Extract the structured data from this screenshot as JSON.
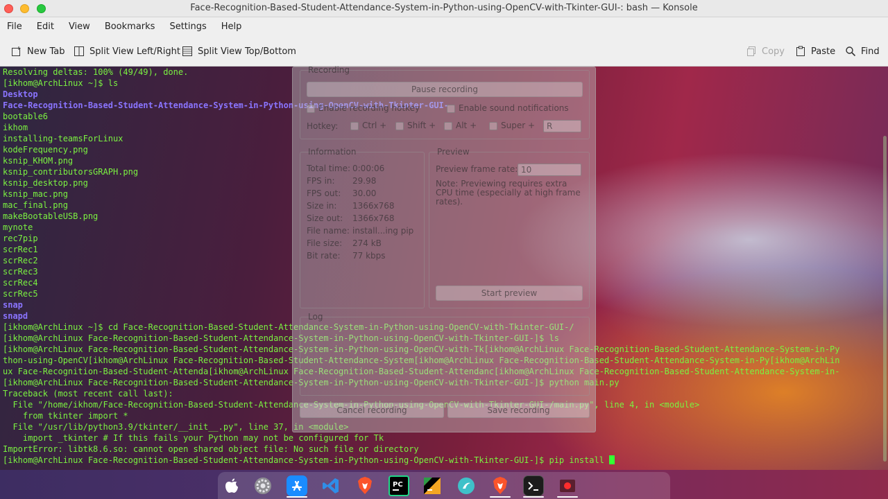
{
  "window": {
    "title": "Face-Recognition-Based-Student-Attendance-System-in-Python-using-OpenCV-with-Tkinter-GUI-: bash — Konsole"
  },
  "menubar": {
    "items": [
      "File",
      "Edit",
      "View",
      "Bookmarks",
      "Settings",
      "Help"
    ]
  },
  "toolbar": {
    "new_tab": "New Tab",
    "split_lr": "Split View Left/Right",
    "split_tb": "Split View Top/Bottom",
    "copy": "Copy",
    "paste": "Paste",
    "find": "Find"
  },
  "terminal": {
    "lines": [
      {
        "text": "Resolving deltas: 100% (49/49), done.",
        "style": "plain"
      },
      {
        "text": "[ikhom@ArchLinux ~]$ ls",
        "style": "plain"
      },
      {
        "text": "Desktop",
        "style": "dir"
      },
      {
        "text": "Face-Recognition-Based-Student-Attendance-System-in-Python-using-OpenCV-with-Tkinter-GUI-",
        "style": "dir"
      },
      {
        "text": "bootable6",
        "style": "plain"
      },
      {
        "text": "ikhom",
        "style": "plain"
      },
      {
        "text": "installing-teamsForLinux",
        "style": "plain"
      },
      {
        "text": "kodeFrequency.png",
        "style": "plain"
      },
      {
        "text": "ksnip_KHOM.png",
        "style": "plain"
      },
      {
        "text": "ksnip_contributorsGRAPH.png",
        "style": "plain"
      },
      {
        "text": "ksnip_desktop.png",
        "style": "plain"
      },
      {
        "text": "ksnip_mac.png",
        "style": "plain"
      },
      {
        "text": "mac_final.png",
        "style": "plain"
      },
      {
        "text": "makeBootableUSB.png",
        "style": "plain"
      },
      {
        "text": "mynote",
        "style": "plain"
      },
      {
        "text": "rec7pip",
        "style": "plain"
      },
      {
        "text": "scrRec1",
        "style": "plain"
      },
      {
        "text": "scrRec2",
        "style": "plain"
      },
      {
        "text": "scrRec3",
        "style": "plain"
      },
      {
        "text": "scrRec4",
        "style": "plain"
      },
      {
        "text": "scrRec5",
        "style": "plain"
      },
      {
        "text": "snap",
        "style": "dir"
      },
      {
        "text": "snapd",
        "style": "dir"
      },
      {
        "text": "[ikhom@ArchLinux ~]$ cd Face-Recognition-Based-Student-Attendance-System-in-Python-using-OpenCV-with-Tkinter-GUI-/",
        "style": "plain"
      },
      {
        "text": "[ikhom@ArchLinux Face-Recognition-Based-Student-Attendance-System-in-Python-using-OpenCV-with-Tkinter-GUI-]$ ls",
        "style": "plain"
      },
      {
        "text": "[ikhom@ArchLinux Face-Recognition-Based-Student-Attendance-System-in-Python-using-OpenCV-with-Tk[ikhom@ArchLinux Face-Recognition-Based-Student-Attendance-System-in-Py",
        "style": "plain"
      },
      {
        "text": "thon-using-OpenCV[ikhom@ArchLinux Face-Recognition-Based-Student-Attendance-System[ikhom@ArchLinux Face-Recognition-Based-Student-Attendance-System-in-Py[ikhom@ArchLin",
        "style": "plain"
      },
      {
        "text": "ux Face-Recognition-Based-Student-Attenda[ikhom@ArchLinux Face-Recognition-Based-Student-Attendanc[ikhom@ArchLinux Face-Recognition-Based-Student-Attendance-System-in-",
        "style": "plain"
      },
      {
        "text": "[ikhom@ArchLinux Face-Recognition-Based-Student-Attendance-System-in-Python-using-OpenCV-with-Tkinter-GUI-]$ python main.py",
        "style": "plain"
      },
      {
        "text": "Traceback (most recent call last):",
        "style": "plain"
      },
      {
        "text": "  File \"/home/ikhom/Face-Recognition-Based-Student-Attendance-System-in-Python-using-OpenCV-with-Tkinter-GUI-/main.py\", line 4, in <module>",
        "style": "plain"
      },
      {
        "text": "    from tkinter import *",
        "style": "plain"
      },
      {
        "text": "  File \"/usr/lib/python3.9/tkinter/__init__.py\", line 37, in <module>",
        "style": "plain"
      },
      {
        "text": "    import _tkinter # If this fails your Python may not be configured for Tk",
        "style": "plain"
      },
      {
        "text": "ImportError: libtk8.6.so: cannot open shared object file: No such file or directory",
        "style": "plain"
      },
      {
        "text": "[ikhom@ArchLinux Face-Recognition-Based-Student-Attendance-System-in-Python-using-OpenCV-with-Tkinter-GUI-]$ pip install ",
        "style": "plain"
      }
    ]
  },
  "recorder": {
    "recording_title": "Recording",
    "pause_label": "Pause recording",
    "enable_hotkey": "Enable recording hotkey",
    "enable_sound": "Enable sound notifications",
    "hotkey_label": "Hotkey:",
    "ctrl": "Ctrl +",
    "shift": "Shift +",
    "alt": "Alt +",
    "super": "Super +",
    "key": "R",
    "information_title": "Information",
    "info": [
      {
        "label": "Total time:",
        "value": "0:00:06"
      },
      {
        "label": "FPS in:",
        "value": "29.98"
      },
      {
        "label": "FPS out:",
        "value": "30.00"
      },
      {
        "label": "Size in:",
        "value": "1366x768"
      },
      {
        "label": "Size out:",
        "value": "1366x768"
      },
      {
        "label": "File name:",
        "value": "install...ing pip"
      },
      {
        "label": "File size:",
        "value": "274 kB"
      },
      {
        "label": "Bit rate:",
        "value": "77 kbps"
      }
    ],
    "preview_title": "Preview",
    "preview_rate_label": "Preview frame rate:",
    "preview_rate_value": "10",
    "preview_note": "Note: Previewing requires extra CPU time (especially at high frame rates).",
    "start_preview": "Start preview",
    "log_title": "Log",
    "cancel_label": "Cancel recording",
    "save_label": "Save recording"
  },
  "dock": {
    "icons": [
      "apple-icon",
      "system-settings-icon",
      "app-store-icon",
      "vscode-icon",
      "brave-icon",
      "pycharm-icon",
      "kotlin-icon",
      "cleaner-icon",
      "brave-browser-icon",
      "terminal-icon",
      "recorder-icon"
    ]
  },
  "colors": {
    "term_text": "#7bf241",
    "term_dir": "#8a74ff",
    "cursor": "#33ff33"
  }
}
